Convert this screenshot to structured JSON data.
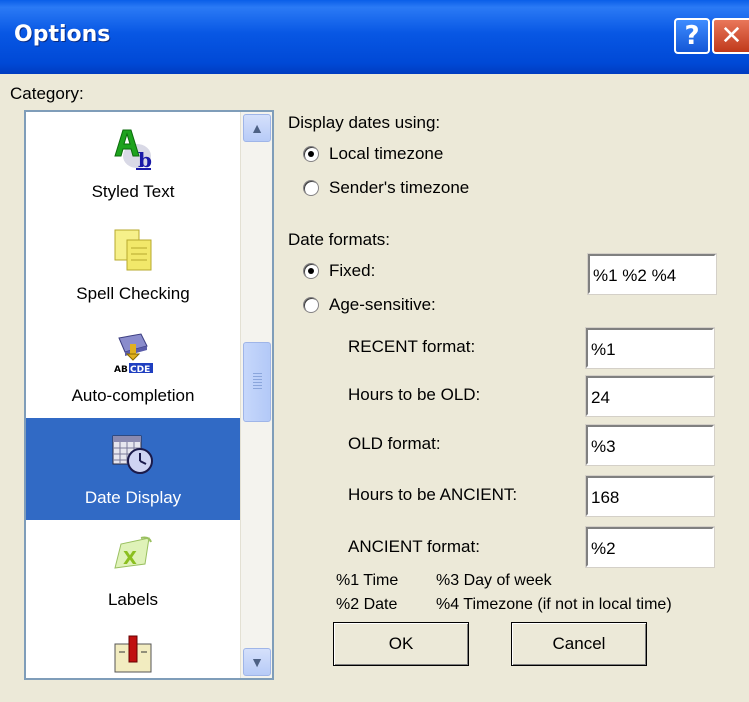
{
  "window": {
    "title": "Options",
    "help_glyph": "?",
    "close_glyph": "✕"
  },
  "category": {
    "label": "Category:",
    "items": [
      {
        "label": "Styled Text",
        "icon": "styled-text-icon"
      },
      {
        "label": "Spell Checking",
        "icon": "spell-check-icon"
      },
      {
        "label": "Auto-completion",
        "icon": "auto-completion-icon"
      },
      {
        "label": "Date Display",
        "icon": "date-display-icon",
        "selected": true
      },
      {
        "label": "Labels",
        "icon": "labels-icon"
      },
      {
        "label": "",
        "icon": "next-category-icon"
      }
    ],
    "scroll_up_glyph": "▲",
    "scroll_down_glyph": "▼"
  },
  "display_dates": {
    "label": "Display dates using:",
    "options": [
      {
        "label": "Local timezone",
        "checked": true
      },
      {
        "label": "Sender's timezone",
        "checked": false
      }
    ]
  },
  "date_formats": {
    "label": "Date formats:",
    "fixed_label": "Fixed:",
    "fixed_checked": true,
    "fixed_value": "%1 %2 %4",
    "age_label": "Age-sensitive:",
    "age_checked": false,
    "fields": [
      {
        "label": "RECENT format:",
        "value": "%1"
      },
      {
        "label": "Hours to be OLD:",
        "value": "24"
      },
      {
        "label": "OLD format:",
        "value": "%3"
      },
      {
        "label": "Hours to be ANCIENT:",
        "value": "168"
      },
      {
        "label": "ANCIENT format:",
        "value": "%2"
      }
    ]
  },
  "legend": {
    "line1_a": "%1 Time",
    "line1_b": "%3 Day of week",
    "line2_a": "%2 Date",
    "line2_b": "%4 Timezone (if not in local time)"
  },
  "buttons": {
    "ok": "OK",
    "cancel": "Cancel"
  }
}
